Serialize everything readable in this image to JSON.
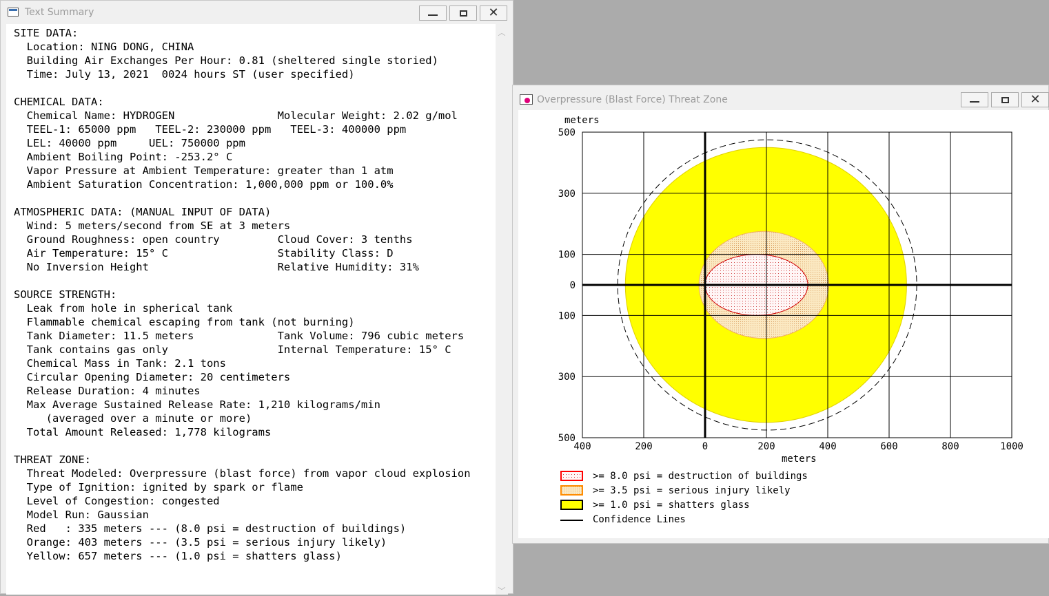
{
  "text_window": {
    "title": "Text Summary",
    "lines": [
      "SITE DATA:",
      "  Location: NING DONG, CHINA",
      "  Building Air Exchanges Per Hour: 0.81 (sheltered single storied)",
      "  Time: July 13, 2021  0024 hours ST (user specified)",
      "",
      "CHEMICAL DATA:",
      "  Chemical Name: HYDROGEN                Molecular Weight: 2.02 g/mol",
      "  TEEL-1: 65000 ppm   TEEL-2: 230000 ppm   TEEL-3: 400000 ppm",
      "  LEL: 40000 ppm     UEL: 750000 ppm",
      "  Ambient Boiling Point: -253.2° C",
      "  Vapor Pressure at Ambient Temperature: greater than 1 atm",
      "  Ambient Saturation Concentration: 1,000,000 ppm or 100.0%",
      "",
      "ATMOSPHERIC DATA: (MANUAL INPUT OF DATA)",
      "  Wind: 5 meters/second from SE at 3 meters",
      "  Ground Roughness: open country         Cloud Cover: 3 tenths",
      "  Air Temperature: 15° C                 Stability Class: D",
      "  No Inversion Height                    Relative Humidity: 31%",
      "",
      "SOURCE STRENGTH:",
      "  Leak from hole in spherical tank",
      "  Flammable chemical escaping from tank (not burning)",
      "  Tank Diameter: 11.5 meters             Tank Volume: 796 cubic meters",
      "  Tank contains gas only                 Internal Temperature: 15° C",
      "  Chemical Mass in Tank: 2.1 tons",
      "  Circular Opening Diameter: 20 centimeters",
      "  Release Duration: 4 minutes",
      "  Max Average Sustained Release Rate: 1,210 kilograms/min",
      "     (averaged over a minute or more)",
      "  Total Amount Released: 1,778 kilograms",
      "",
      "THREAT ZONE:",
      "  Threat Modeled: Overpressure (blast force) from vapor cloud explosion",
      "  Type of Ignition: ignited by spark or flame",
      "  Level of Congestion: congested",
      "  Model Run: Gaussian",
      "  Red   : 335 meters --- (8.0 psi = destruction of buildings)",
      "  Orange: 403 meters --- (3.5 psi = serious injury likely)",
      "  Yellow: 657 meters --- (1.0 psi = shatters glass)"
    ]
  },
  "zone_window": {
    "title": "Overpressure (Blast Force) Threat Zone",
    "ylabel": "meters",
    "xlabel": "meters",
    "y_ticks": [
      "500",
      "300",
      "100",
      "0",
      "100",
      "300",
      "500"
    ],
    "x_ticks": [
      "400",
      "200",
      "0",
      "200",
      "400",
      "600",
      "800",
      "1000"
    ],
    "legend": [
      {
        "label": ">= 8.0 psi = destruction of buildings",
        "color": "#ff0000",
        "fill": "#ffe8e8"
      },
      {
        "label": ">= 3.5 psi = serious injury likely",
        "color": "#ff8c00",
        "fill": "#ffd28a"
      },
      {
        "label": ">= 1.0 psi = shatters glass",
        "color": "#000000",
        "fill": "#ffff00"
      },
      {
        "label": "Confidence Lines",
        "color": "#000000",
        "fill": "none"
      }
    ]
  },
  "chart_data": {
    "type": "area",
    "xlabel": "meters",
    "ylabel": "meters",
    "x_tick_labels": [
      "400",
      "200",
      "0",
      "200",
      "400",
      "600",
      "800",
      "1000"
    ],
    "y_tick_labels": [
      "500",
      "300",
      "100",
      "0",
      "100",
      "300",
      "500"
    ],
    "xlim": [
      -400,
      1000
    ],
    "ylim": [
      -500,
      500
    ],
    "grid": true,
    "zones": [
      {
        "name": ">= 8.0 psi = destruction of buildings",
        "color": "#ff0000",
        "x_extent": [
          0,
          335
        ],
        "y_extent": [
          -100,
          100
        ]
      },
      {
        "name": ">= 3.5 psi = serious injury likely",
        "color": "#ff8c00",
        "x_extent": [
          -20,
          403
        ],
        "y_extent": [
          -175,
          175
        ]
      },
      {
        "name": ">= 1.0 psi = shatters glass",
        "color": "#ffff00",
        "x_extent": [
          -260,
          657
        ],
        "y_extent": [
          -450,
          450
        ]
      }
    ],
    "confidence_lines": {
      "x_extent": [
        -285,
        690
      ],
      "y_extent": [
        -475,
        475
      ]
    }
  }
}
